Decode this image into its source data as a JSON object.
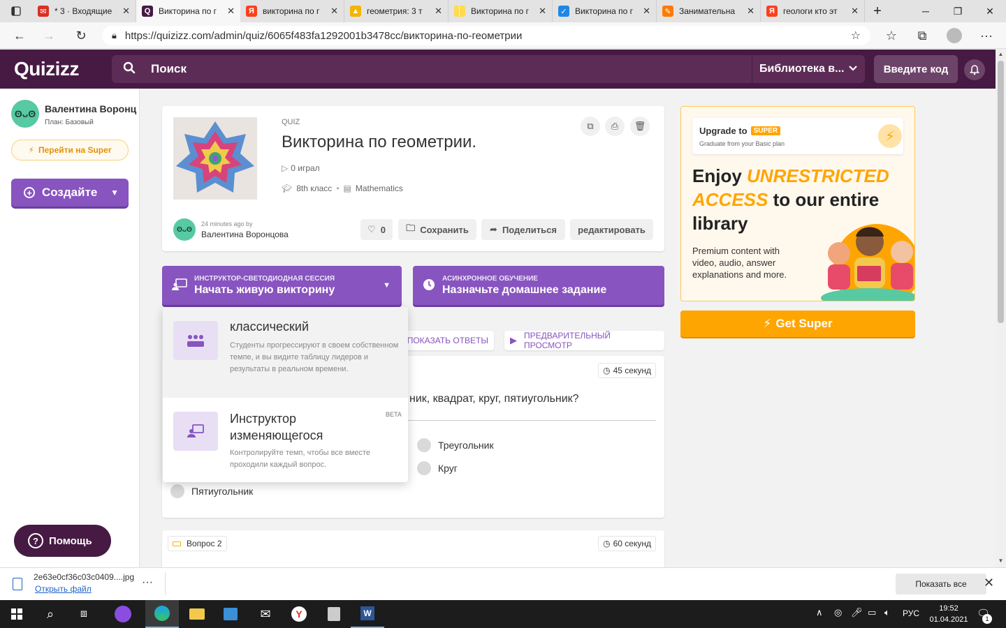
{
  "browser": {
    "tabs": [
      {
        "title": "* 3 · Входящие",
        "fav_color": "#d93025",
        "fav_glyph": "✉",
        "fav_icon": "mail-icon"
      },
      {
        "title": "Викторина по г",
        "fav_color": "#461a42",
        "fav_glyph": "Q",
        "fav_icon": "quizizz-icon",
        "active": true
      },
      {
        "title": "викторина по г",
        "fav_color": "#fc3f1d",
        "fav_glyph": "Я",
        "fav_icon": "yandex-icon"
      },
      {
        "title": "геометрия: 3 т",
        "fav_color": "#f5b400",
        "fav_glyph": "▲",
        "fav_icon": "image-icon"
      },
      {
        "title": "Викторина по г",
        "fav_color": "#ffdb4d",
        "fav_glyph": "│",
        "fav_icon": "doc-icon"
      },
      {
        "title": "Викторина по г",
        "fav_color": "#1e88e5",
        "fav_glyph": "✓",
        "fav_icon": "check-icon"
      },
      {
        "title": "Занимательна",
        "fav_color": "#ff7a00",
        "fav_glyph": "✎",
        "fav_icon": "pencil-icon"
      },
      {
        "title": "геологи кто эт",
        "fav_color": "#fc3f1d",
        "fav_glyph": "Я",
        "fav_icon": "yandex-icon"
      }
    ],
    "url": "https://quizizz.com/admin/quiz/6065f483fa1292001b3478cc/викторина-по-геометрии"
  },
  "header": {
    "logo": "Quizizz",
    "search_placeholder": "Поиск",
    "library": "Библиотека в...",
    "enter_code": "Введите код"
  },
  "sidebar": {
    "user_name": "Валентина Воронц",
    "plan": "План: Базовый",
    "super_button": "Перейти на Super",
    "create_button": "Создайте",
    "help_button": "Помощь"
  },
  "quiz": {
    "type": "QUIZ",
    "title": "Викторина по геометрии.",
    "plays": "0 играл",
    "grade": "8th класс",
    "subject": "Mathematics",
    "created_ago": "24 minutes ago by",
    "author": "Валентина Воронцова",
    "likes": "0",
    "save": "Сохранить",
    "share": "Поделиться",
    "edit": "редактировать"
  },
  "actions": {
    "live_small": "ИНСТРУКТОР-СВЕТОДИОДНАЯ СЕССИЯ",
    "live_big": "Начать живую викторину",
    "hw_small": "АСИНХРОННОЕ ОБУЧЕНИЕ",
    "hw_big": "Назначьте домашнее задание",
    "show_answers": "ПОКАЗАТЬ ОТВЕТЫ",
    "preview": "ПРЕДВАРИТЕЛЬНЫЙ ПРОСМОТР"
  },
  "dropdown": {
    "classic_title": "классический",
    "classic_desc": "Студенты прогрессируют в своем собственном темпе, и вы видите таблицу лидеров и результаты в реальном времени.",
    "instructor_title": "Инструктор изменяющегося",
    "instructor_badge": "BETA",
    "instructor_desc": "Контролируйте темп, чтобы все вместе проходили каждый вопрос."
  },
  "question1": {
    "time": "45 секунд",
    "text_visible": "ник, квадрат, круг, пятиугольник?",
    "options": [
      "Треугольник",
      "Круг",
      "Пятиугольник"
    ]
  },
  "question2": {
    "label": "Вопрос 2",
    "time": "60 секунд"
  },
  "promo": {
    "upgrade_to": "Upgrade to",
    "super_badge": "SUPER",
    "graduate": "Graduate from your Basic plan",
    "headline_enjoy": "Enjoy",
    "headline_unrestricted": "UNRESTRICTED",
    "headline_access": "ACCESS",
    "headline_rest": "to our entire library",
    "body": "Premium content with video, audio, answer explanations and more.",
    "get_super": "Get Super"
  },
  "download": {
    "filename": "2e63e0cf36c03c0409....jpg",
    "open_file": "Открыть файл",
    "show_all": "Показать все"
  },
  "taskbar": {
    "lang": "РУС",
    "time": "19:52",
    "date": "01.04.2021",
    "notif_count": "1"
  }
}
